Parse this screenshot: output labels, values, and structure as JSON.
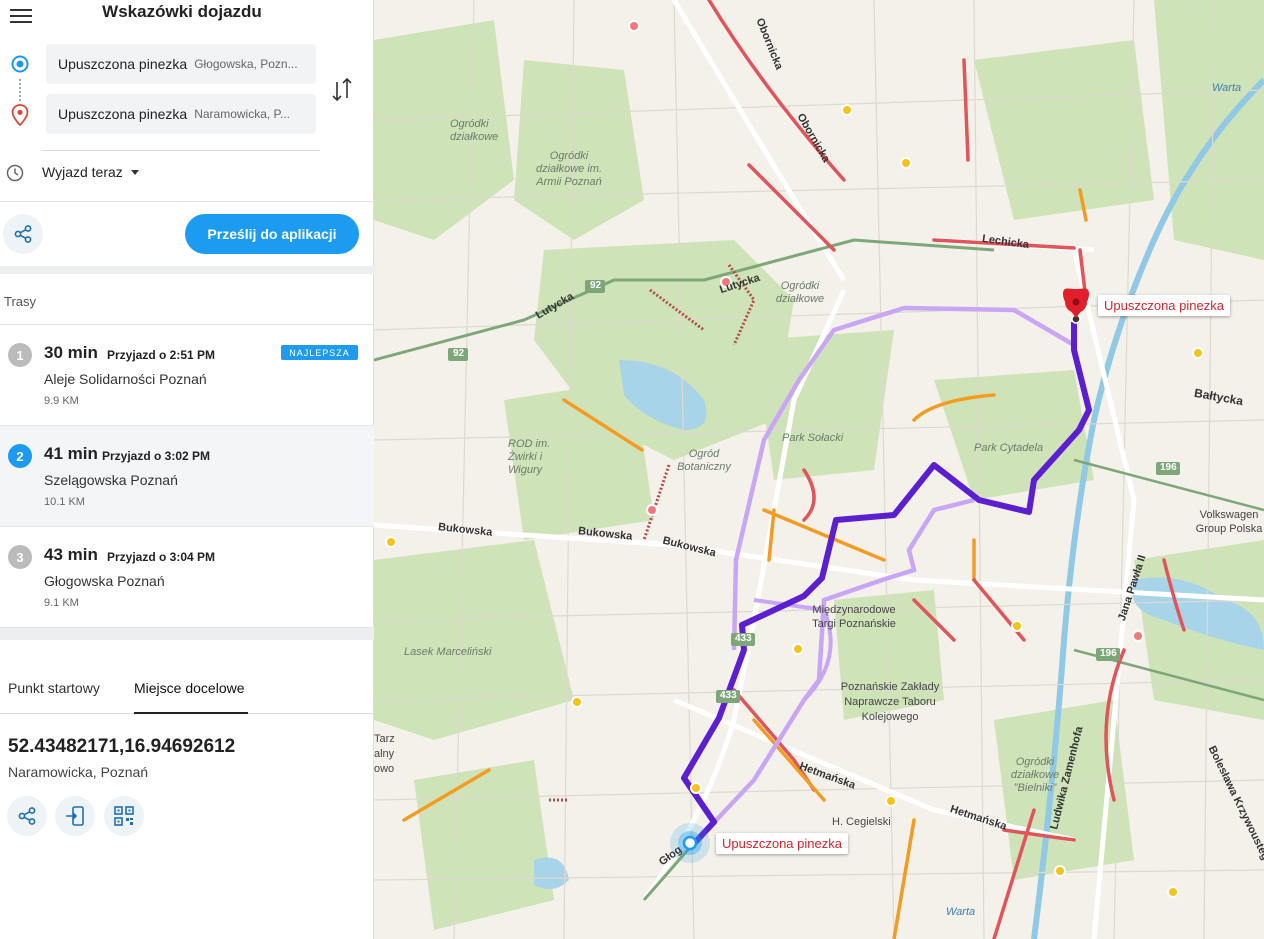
{
  "header": {
    "title": "Wskazówki dojazdu"
  },
  "start": {
    "main": "Upuszczona pinezka",
    "sub": "Głogowska, Pozn..."
  },
  "end": {
    "main": "Upuszczona pinezka",
    "sub": "Naramowicka, P..."
  },
  "depart": {
    "label": "Wyjazd teraz"
  },
  "actions": {
    "send_label": "Prześlij do aplikacji"
  },
  "routes_header": "Trasy",
  "routes": [
    {
      "num": "1",
      "time": "30 min",
      "arrival": "Przyjazd o 2:51 PM",
      "via": "Aleje Solidarności Poznań",
      "dist": "9.9 KM",
      "badge": "NAJLEPSZA"
    },
    {
      "num": "2",
      "time": "41 min",
      "arrival": "Przyjazd o 3:02 PM",
      "via": "Szelągowska Poznań",
      "dist": "10.1 KM"
    },
    {
      "num": "3",
      "time": "43 min",
      "arrival": "Przyjazd o 3:04 PM",
      "via": "Głogowska Poznań",
      "dist": "9.1 KM"
    }
  ],
  "tabs": {
    "start": "Punkt startowy",
    "destination": "Miejsce docelowe"
  },
  "destination": {
    "coords": "52.43482171,16.94692612",
    "street": "Naramowicka, Poznań"
  },
  "map": {
    "pin_label_end": "Upuszczona pinezka",
    "pin_label_start": "Upuszczona pinezka",
    "labels": {
      "obornicka": "Obornicka",
      "obornicka2": "Obornicka",
      "lechicka": "Lechicka",
      "lutycka": "Lutycka",
      "lutycka2": "Lutycka",
      "baltycka": "Bałtycka",
      "bukowska": "Bukowska",
      "bukowska2": "Bukowska",
      "bukowska3": "Bukowska",
      "hetmanska": "Hetmańska",
      "hetmanska2": "Hetmańska",
      "hcegielski": "H. Cegielski",
      "mtp": "Międzynarodowe Targi Poznańskie",
      "hcp": "Poznańskie Zakłady Naprawcze Taboru Kolejowego",
      "parksolacki": "Park Sołacki",
      "parkcytadela": "Park Cytadela",
      "ogrodbot": "Ogród Botaniczny",
      "ogrdzial1": "Ogródki działkowe",
      "ogrdzial2": "Ogródki działkowe im. Armii Poznań",
      "ogrdzial3": "Ogródki działkowe",
      "ogrdzial4": "Ogródki działkowe \"Bielniki\"",
      "rod": "ROD im. Żwirki i Wigury",
      "lasek": "Lasek Marceliński",
      "vw": "Volkswagen Group Polska",
      "warta1": "Warta",
      "warta2": "Warta",
      "zamenhofa": "Ludwika Zamenhofa",
      "krzywoustego": "Bolesława Krzywoustego",
      "jpii": "Jana Pawła II",
      "glog": "Głog",
      "tarz": "Tarz alny owo",
      "r92a": "92",
      "r92b": "92",
      "r196a": "196",
      "r196b": "196",
      "r433a": "433",
      "r433b": "433"
    }
  }
}
